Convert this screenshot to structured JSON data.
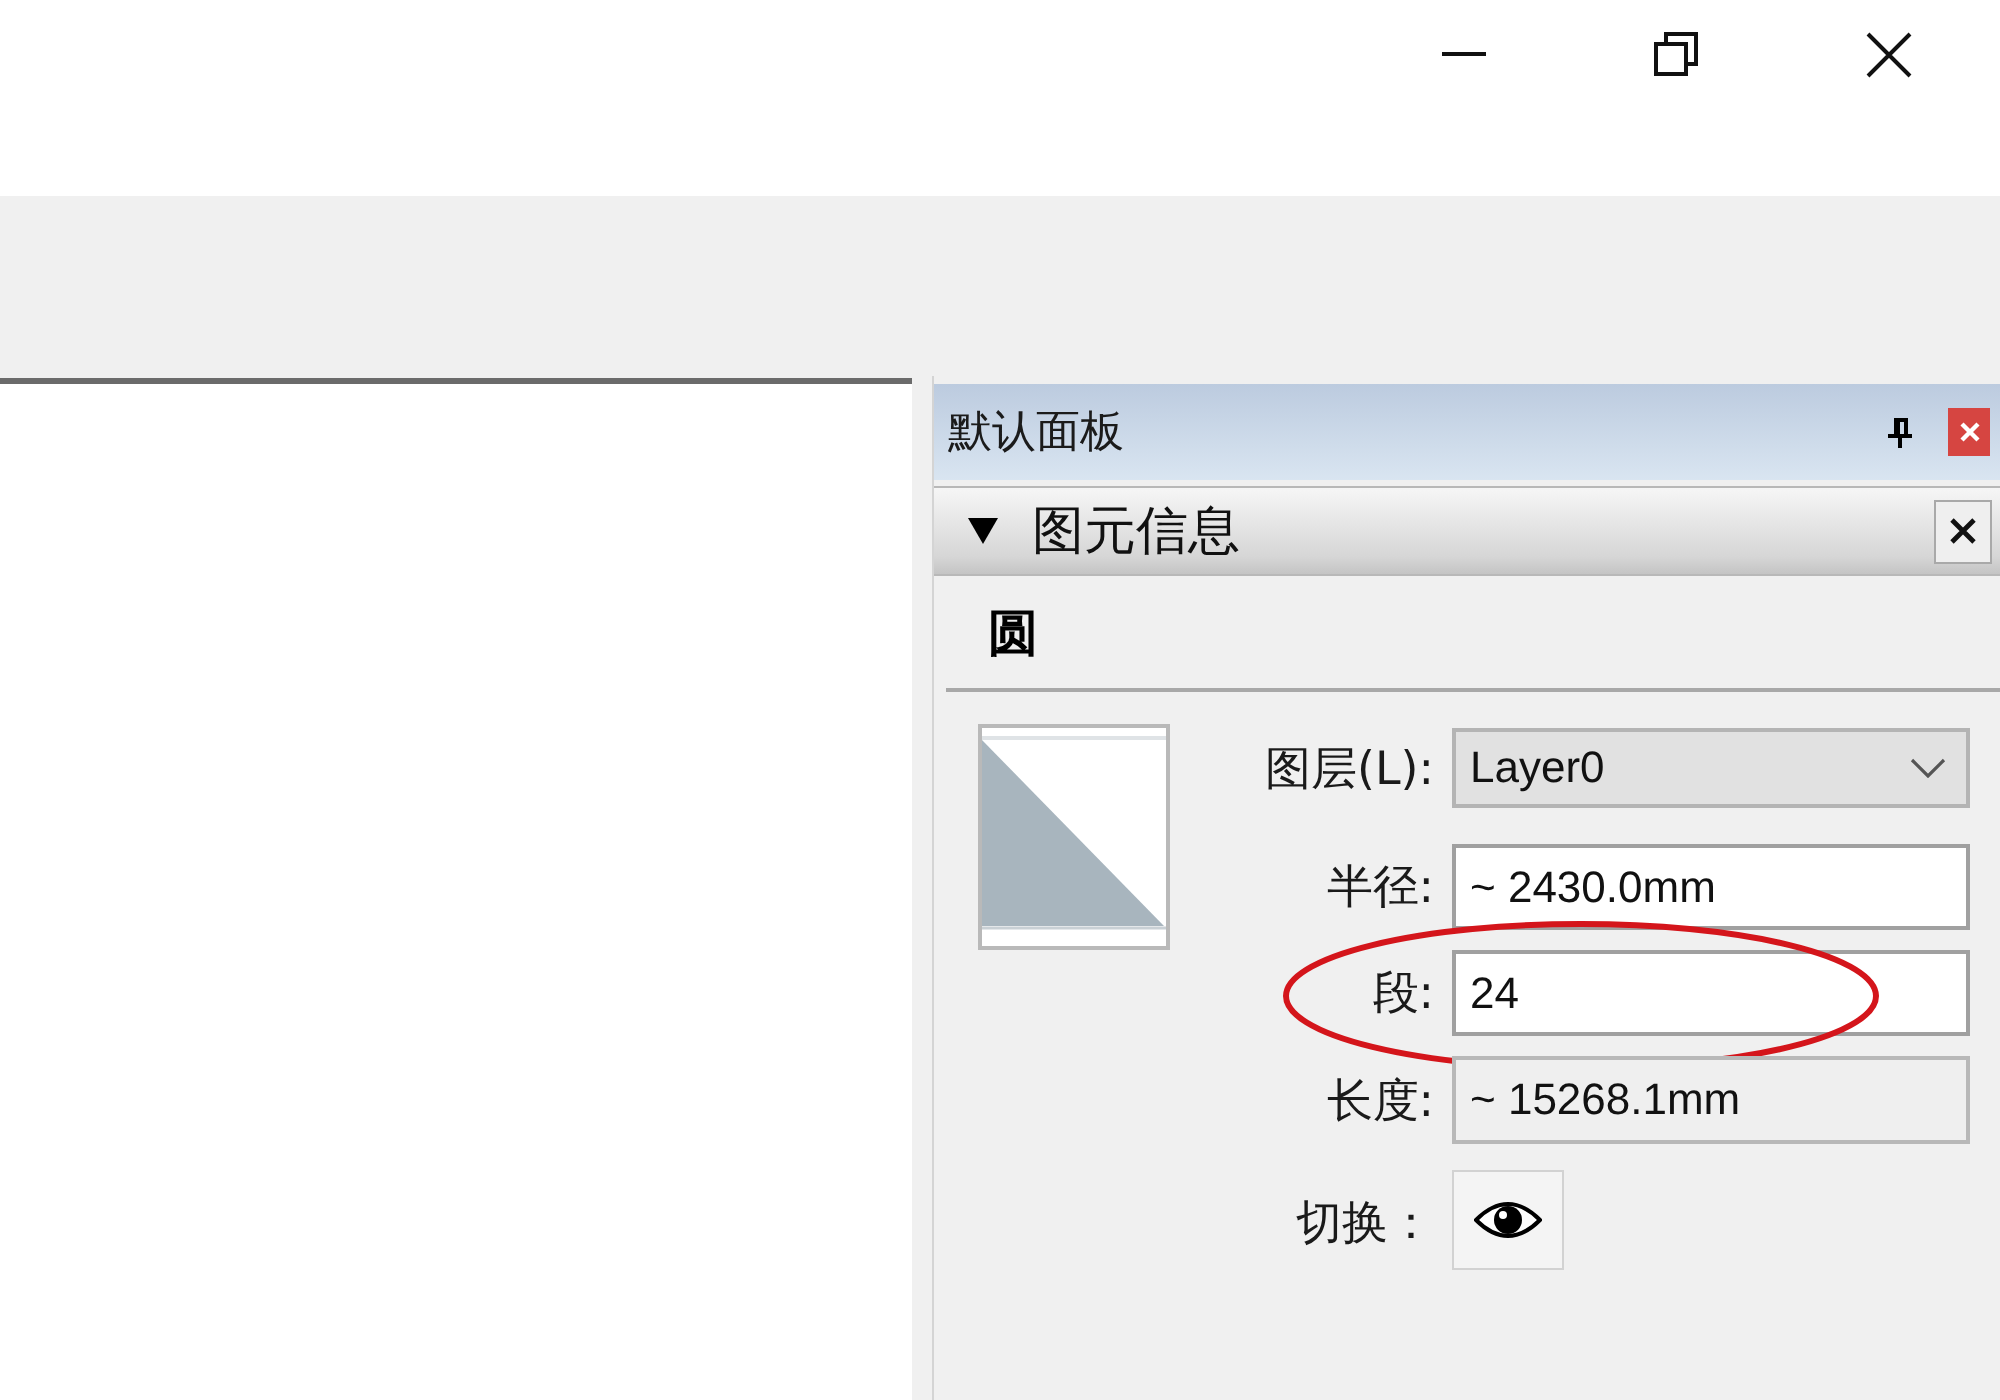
{
  "panel": {
    "title": "默认面板"
  },
  "section": {
    "title": "图元信息",
    "expanded": true,
    "entity_type": "圆"
  },
  "fields": [
    {
      "kind": "dropdown",
      "label": "图层(L):",
      "value": "Layer0",
      "highlighted": false
    },
    {
      "kind": "text",
      "label": "半径:",
      "value": "~ 2430.0mm",
      "highlighted": false
    },
    {
      "kind": "text",
      "label": "段:",
      "value": "24",
      "highlighted": true
    },
    {
      "kind": "readonly",
      "label": "长度:",
      "value": "~ 15268.1mm",
      "highlighted": false
    },
    {
      "kind": "toggles",
      "label": "切换：",
      "highlighted": false
    }
  ]
}
